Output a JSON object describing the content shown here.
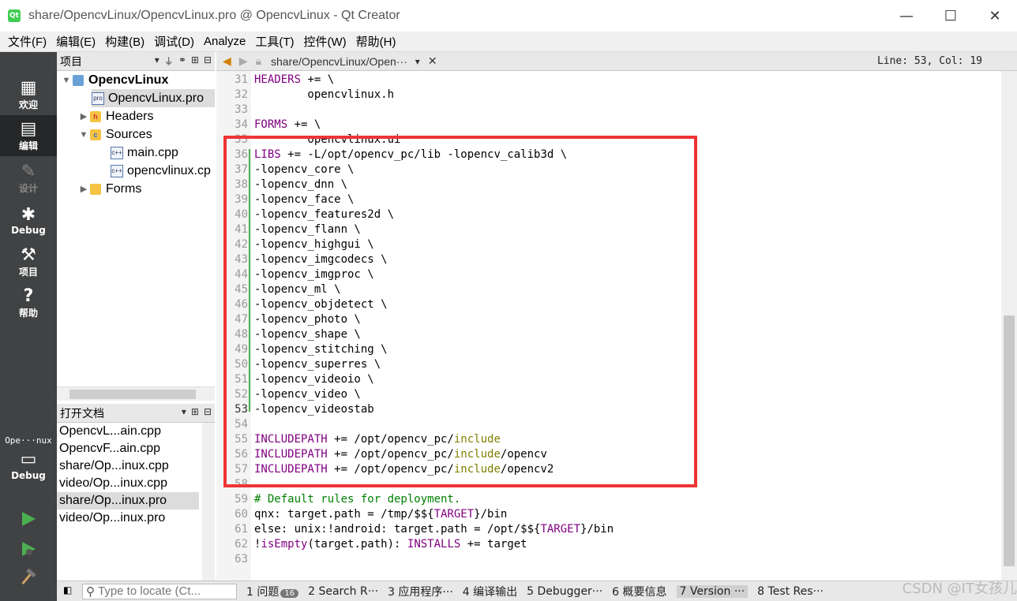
{
  "window": {
    "title": "share/OpencvLinux/OpencvLinux.pro @ OpencvLinux - Qt Creator",
    "minimize": "—",
    "maximize": "☐",
    "close": "✕"
  },
  "menubar": [
    "文件(F)",
    "编辑(E)",
    "构建(B)",
    "调试(D)",
    "Analyze",
    "工具(T)",
    "控件(W)",
    "帮助(H)"
  ],
  "modes": [
    {
      "label": "欢迎",
      "icon": "grid-icon"
    },
    {
      "label": "编辑",
      "icon": "edit-icon"
    },
    {
      "label": "设计",
      "icon": "pencil-icon"
    },
    {
      "label": "Debug",
      "icon": "bug-icon"
    },
    {
      "label": "项目",
      "icon": "wrench-icon"
    },
    {
      "label": "帮助",
      "icon": "help-icon"
    }
  ],
  "target": {
    "project": "Ope···nux",
    "config": "Debug"
  },
  "project_panel": {
    "title": "项目",
    "tree": [
      {
        "label": "OpencvLinux",
        "depth": 0,
        "expanded": true,
        "bold": true
      },
      {
        "label": "OpencvLinux.pro",
        "depth": 1,
        "selected": true
      },
      {
        "label": "Headers",
        "depth": 1,
        "expanded": false
      },
      {
        "label": "Sources",
        "depth": 1,
        "expanded": true
      },
      {
        "label": "main.cpp",
        "depth": 2
      },
      {
        "label": "opencvlinux.cp",
        "depth": 2
      },
      {
        "label": "Forms",
        "depth": 1,
        "expanded": false
      }
    ]
  },
  "open_docs": {
    "title": "打开文档",
    "items": [
      {
        "label": "OpencvL...ain.cpp"
      },
      {
        "label": "OpencvF...ain.cpp"
      },
      {
        "label": "share/Op...inux.cpp"
      },
      {
        "label": "video/Op...inux.cpp"
      },
      {
        "label": "share/Op...inux.pro",
        "selected": true
      },
      {
        "label": "video/Op...inux.pro"
      }
    ]
  },
  "editor": {
    "file": "share/OpencvLinux/Open···",
    "position": "Line: 53, Col: 19",
    "lines": [
      {
        "n": "31",
        "t": "HEADERS += \\"
      },
      {
        "n": "32",
        "t": "        opencvlinux.h"
      },
      {
        "n": "33",
        "t": ""
      },
      {
        "n": "34",
        "t": "FORMS += \\"
      },
      {
        "n": "35",
        "t": "        opencvlinux.ui"
      },
      {
        "n": "36",
        "t": "LIBS += -L/opt/opencv_pc/lib -lopencv_calib3d \\"
      },
      {
        "n": "37",
        "t": "-lopencv_core \\"
      },
      {
        "n": "38",
        "t": "-lopencv_dnn \\"
      },
      {
        "n": "39",
        "t": "-lopencv_face \\"
      },
      {
        "n": "40",
        "t": "-lopencv_features2d \\"
      },
      {
        "n": "41",
        "t": "-lopencv_flann \\"
      },
      {
        "n": "42",
        "t": "-lopencv_highgui \\"
      },
      {
        "n": "43",
        "t": "-lopencv_imgcodecs \\"
      },
      {
        "n": "44",
        "t": "-lopencv_imgproc \\"
      },
      {
        "n": "45",
        "t": "-lopencv_ml \\"
      },
      {
        "n": "46",
        "t": "-lopencv_objdetect \\"
      },
      {
        "n": "47",
        "t": "-lopencv_photo \\"
      },
      {
        "n": "48",
        "t": "-lopencv_shape \\"
      },
      {
        "n": "49",
        "t": "-lopencv_stitching \\"
      },
      {
        "n": "50",
        "t": "-lopencv_superres \\"
      },
      {
        "n": "51",
        "t": "-lopencv_videoio \\"
      },
      {
        "n": "52",
        "t": "-lopencv_video \\"
      },
      {
        "n": "53",
        "t": "-lopencv_videostab"
      },
      {
        "n": "54",
        "t": ""
      },
      {
        "n": "55",
        "t": "INCLUDEPATH += /opt/opencv_pc/include"
      },
      {
        "n": "56",
        "t": "INCLUDEPATH += /opt/opencv_pc/include/opencv"
      },
      {
        "n": "57",
        "t": "INCLUDEPATH += /opt/opencv_pc/include/opencv2"
      },
      {
        "n": "58",
        "t": ""
      },
      {
        "n": "59",
        "t": "# Default rules for deployment."
      },
      {
        "n": "60",
        "t": "qnx: target.path = /tmp/$${TARGET}/bin"
      },
      {
        "n": "61",
        "t": "else: unix:!android: target.path = /opt/$${TARGET}/bin"
      },
      {
        "n": "62",
        "t": "!isEmpty(target.path): INSTALLS += target"
      },
      {
        "n": "63",
        "t": ""
      }
    ]
  },
  "bottombar": {
    "locator_placeholder": "Type to locate (Ct...",
    "panes": [
      {
        "label": "1 问题",
        "badge": "16"
      },
      {
        "label": "2 Search R···"
      },
      {
        "label": "3 应用程序···"
      },
      {
        "label": "4 编译输出"
      },
      {
        "label": "5 Debugger···"
      },
      {
        "label": "6 概要信息"
      },
      {
        "label": "7 Version ···",
        "active": true
      },
      {
        "label": "8 Test Res···"
      }
    ]
  },
  "watermark": "CSDN @IT女孩儿",
  "colors": {
    "highlight_box": "#ee3434",
    "keyword": "#800080",
    "path": "#808000",
    "comment": "#008000"
  }
}
